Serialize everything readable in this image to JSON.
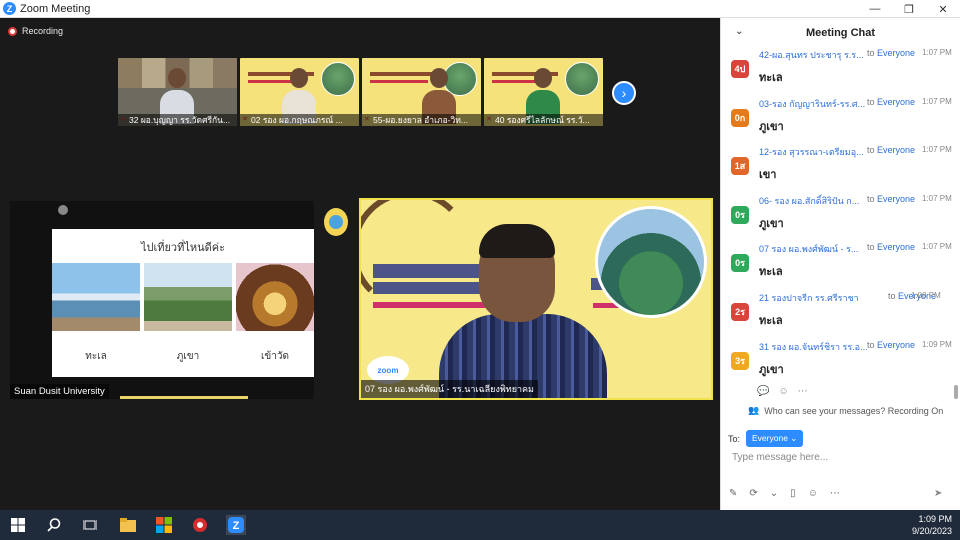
{
  "window": {
    "title": "Zoom Meeting",
    "minimize": "—",
    "restore": "❐",
    "close": "✕"
  },
  "meeting": {
    "recording_label": "Recording",
    "thumbnails": [
      {
        "label": "32 ผอ.บุญญา รร.วัดศรีกัน..."
      },
      {
        "label": "02 รอง ผอ.กฤษณภรณ์ ..."
      },
      {
        "label": "55-ผอ.ยงยาล อำเภอ-วิท..."
      },
      {
        "label": "40 รองศรีไลลักษณ์ รร.วั..."
      }
    ],
    "next_arrow": "›",
    "left_tile": {
      "name": "Suan Dusit University",
      "slide_title": "ไปเที่ยวที่ไหนดีค่ะ",
      "captions": [
        "ทะเล",
        "ภูเขา",
        "เข้าวัด"
      ]
    },
    "main_tile": {
      "name": "07 รอง ผอ.พงศ์พัฒน์ - รร.นาเฉลียงพิทยาคม"
    },
    "zoom_logo_text": "zoom"
  },
  "chat": {
    "title": "Meeting Chat",
    "messages": [
      {
        "avatar": "4ป",
        "color": "#d9453b",
        "sender": "42-ผอ.สุนทร ประชารุ ร.ร...",
        "to": "Everyone",
        "time": "1:07 PM",
        "text": "ทะเล"
      },
      {
        "avatar": "0ก",
        "color": "#e57a1a",
        "sender": "03-รอง กัญญารินทร์-รร.ศ...",
        "to": "Everyone",
        "time": "1:07 PM",
        "text": "ภูเขา"
      },
      {
        "avatar": "1ส",
        "color": "#e0662a",
        "sender": "12-รอง สุวรรณา-เตรียมอุ...",
        "to": "Everyone",
        "time": "1:07 PM",
        "text": "เขา"
      },
      {
        "avatar": "0ร",
        "color": "#2ea85a",
        "sender": "06- รอง ผอ.สักดิ์สิริปัน ก...",
        "to": "Everyone",
        "time": "1:07 PM",
        "text": "ภูเขา"
      },
      {
        "avatar": "0ร",
        "color": "#2ea85a",
        "sender": "07 รอง ผอ.พงศ์พัฒน์ - ร...",
        "to": "Everyone",
        "time": "1:07 PM",
        "text": "ทะเล"
      },
      {
        "avatar": "2ร",
        "color": "#d9453b",
        "sender": "21 รองปาจรีก รร.ศรีราชา",
        "to": "Everyone",
        "time": "1:08 PM",
        "text": "ทะเล"
      },
      {
        "avatar": "3ร",
        "color": "#f0a820",
        "sender": "31 รอง ผอ.จันทร์ชิรา รร.อ...",
        "to": "Everyone",
        "time": "1:09 PM",
        "text": "ภูเขา"
      }
    ],
    "to_word": "to",
    "who_can_see": "Who can see your messages? Recording On",
    "to_label": "To:",
    "to_target": "Everyone ⌄",
    "placeholder": "Type message here..."
  },
  "taskbar": {
    "time": "1:09 PM",
    "date": "9/20/2023"
  }
}
